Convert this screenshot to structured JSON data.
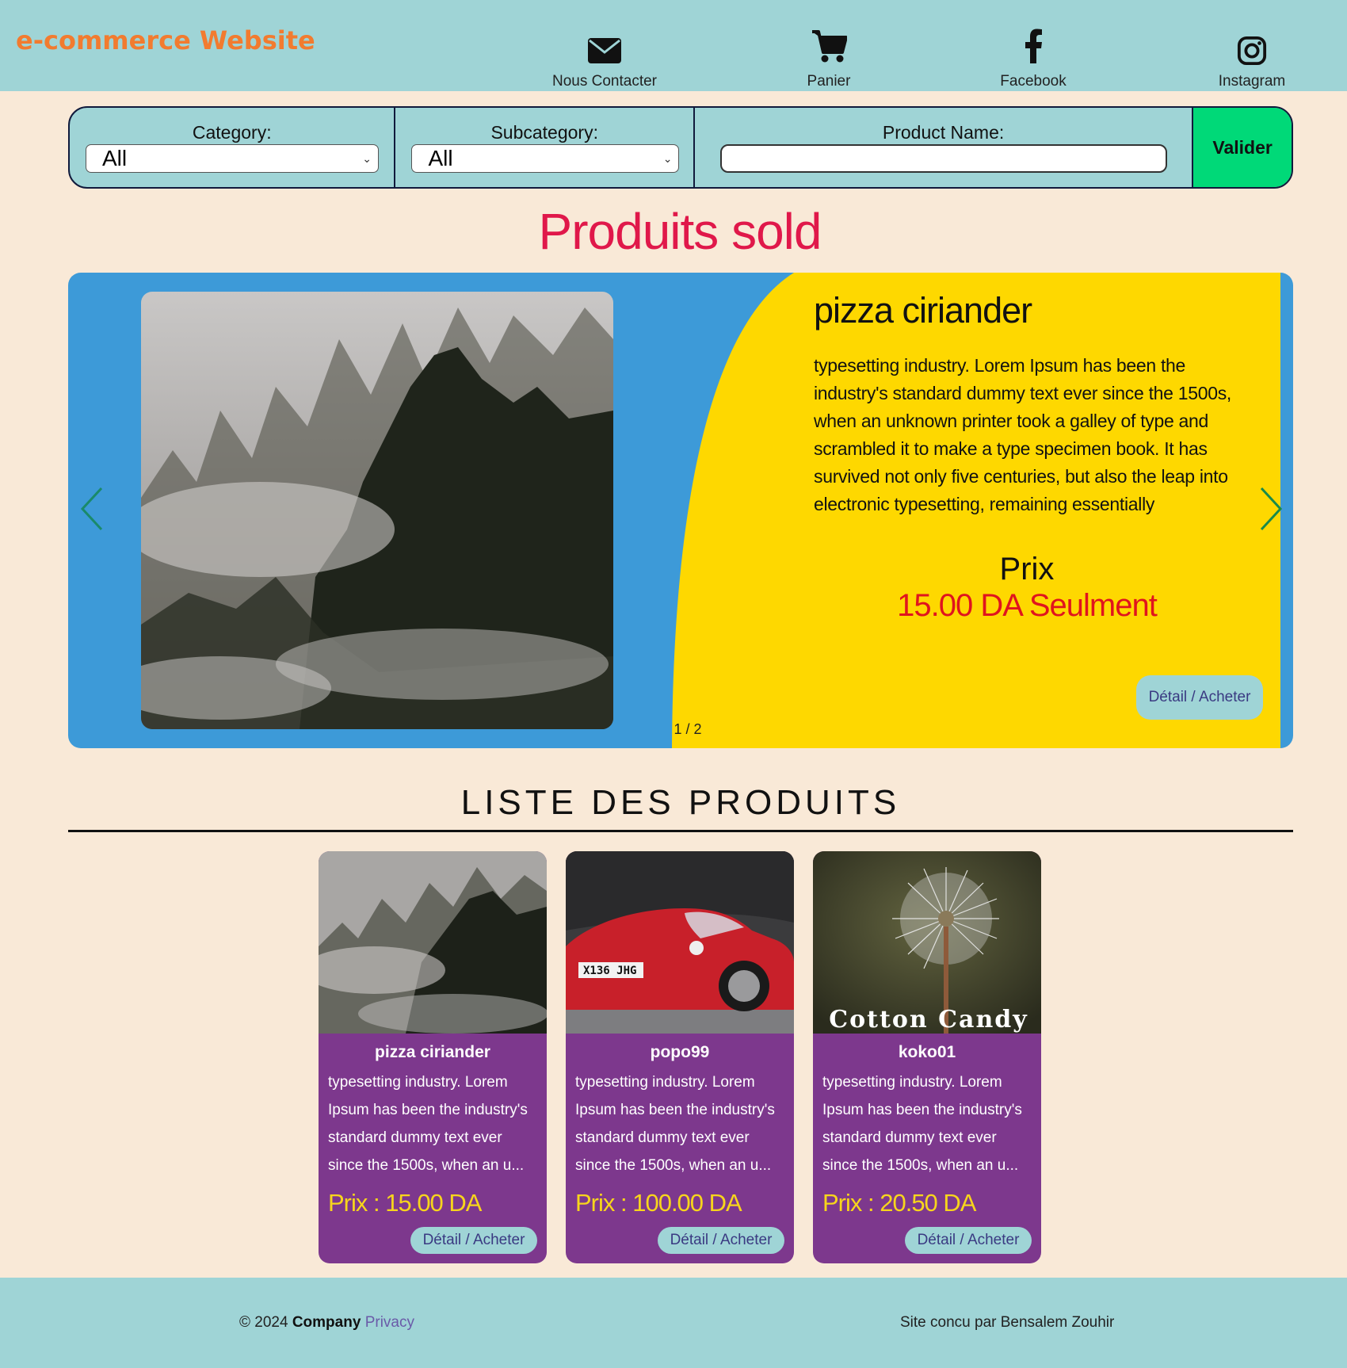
{
  "header": {
    "brand": "e-commerce Website",
    "nav": [
      {
        "label": "Nous Contacter",
        "icon": "envelope-icon"
      },
      {
        "label": "Panier",
        "icon": "cart-icon"
      },
      {
        "label": "Facebook",
        "icon": "facebook-icon"
      },
      {
        "label": "Instagram",
        "icon": "instagram-icon"
      }
    ]
  },
  "filter": {
    "category_label": "Category:",
    "category_value": "All",
    "subcategory_label": "Subcategory:",
    "subcategory_value": "All",
    "product_name_label": "Product Name:",
    "product_name_value": "",
    "submit_label": "Valider"
  },
  "sold": {
    "title": "Produits sold",
    "slide": {
      "name": "pizza ciriander",
      "description": "typesetting industry. Lorem Ipsum has been the industry's standard dummy text ever since the 1500s, when an unknown printer took a galley of type and scrambled it to make a type specimen book. It has survived not only five centuries, but also the leap into electronic typesetting, remaining essentially",
      "prix_label": "Prix",
      "price": "15.00 DA Seulment",
      "button": "Détail / Acheter",
      "image": "misty-forest"
    },
    "counter": "1 / 2"
  },
  "list": {
    "title": "LISTE DES PRODUITS",
    "products": [
      {
        "name": "pizza ciriander",
        "desc": "typesetting industry. Lorem Ipsum has been the industry's standard dummy text ever since the 1500s, when an u...",
        "price": "Prix : 15.00 DA",
        "button": "Détail / Acheter",
        "image": "misty-forest"
      },
      {
        "name": "popo99",
        "desc": "typesetting industry. Lorem Ipsum has been the industry's standard dummy text ever since the 1500s, when an u...",
        "price": "Prix : 100.00 DA",
        "button": "Détail / Acheter",
        "image": "red-sports-car"
      },
      {
        "name": "koko01",
        "desc": "typesetting industry. Lorem Ipsum has been the industry's standard dummy text ever since the 1500s, when an u...",
        "price": "Prix : 20.50 DA",
        "button": "Détail / Acheter",
        "image": "dandelion",
        "image_caption": "Cotton Candy"
      }
    ]
  },
  "footer": {
    "copyright": "© 2024",
    "company": "Company",
    "privacy": "Privacy",
    "credit": "Site concu par Bensalem Zouhir"
  },
  "colors": {
    "header_bg": "#9fd4d6",
    "page_bg": "#f9e9d7",
    "brand": "#f27b2f",
    "accent_red": "#e0184a",
    "carousel_blue": "#3d9ad8",
    "carousel_yellow": "#fed800",
    "card_purple": "#7d388d",
    "price_yellow": "#f7d51c",
    "valider_green": "#00d978"
  }
}
